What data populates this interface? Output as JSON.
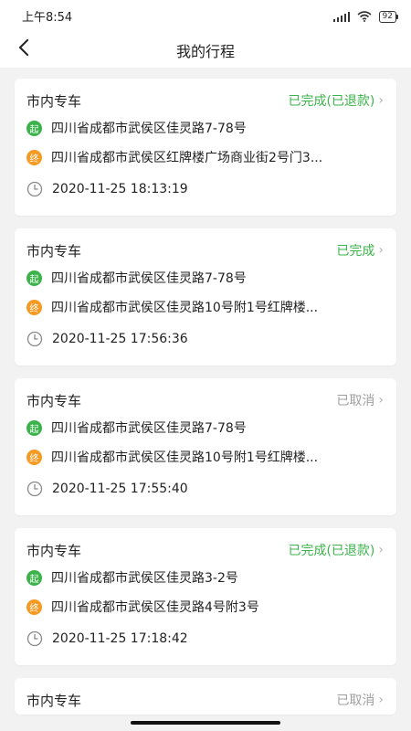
{
  "status_bar": {
    "time": "上午8:54",
    "battery": "92"
  },
  "header": {
    "title": "我的行程"
  },
  "orders": [
    {
      "type": "市内专车",
      "status": "已完成(已退款)",
      "status_color": "#3bb34a",
      "start_tag": "起",
      "end_tag": "终",
      "start": "四川省成都市武侯区佳灵路7-78号",
      "end": "四川省成都市武侯区红牌楼广场商业街2号门3...",
      "time": "2020-11-25 18:13:19"
    },
    {
      "type": "市内专车",
      "status": "已完成",
      "status_color": "#3bb34a",
      "start_tag": "起",
      "end_tag": "终",
      "start": "四川省成都市武侯区佳灵路7-78号",
      "end": "四川省成都市武侯区佳灵路10号附1号红牌楼...",
      "time": "2020-11-25 17:56:36"
    },
    {
      "type": "市内专车",
      "status": "已取消",
      "status_color": "#9e9e9e",
      "start_tag": "起",
      "end_tag": "终",
      "start": "四川省成都市武侯区佳灵路7-78号",
      "end": "四川省成都市武侯区佳灵路10号附1号红牌楼...",
      "time": "2020-11-25 17:55:40"
    },
    {
      "type": "市内专车",
      "status": "已完成(已退款)",
      "status_color": "#3bb34a",
      "start_tag": "起",
      "end_tag": "终",
      "start": "四川省成都市武侯区佳灵路3-2号",
      "end": "四川省成都市武侯区佳灵路4号附3号",
      "time": "2020-11-25 17:18:42"
    },
    {
      "type": "市内专车",
      "status": "已取消",
      "status_color": "#9e9e9e"
    }
  ]
}
